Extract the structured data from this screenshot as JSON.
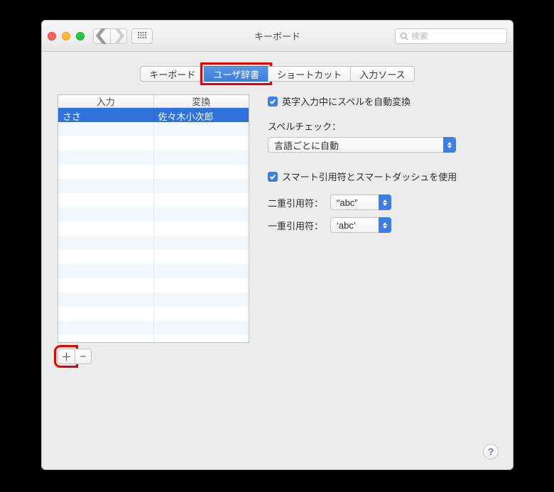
{
  "window": {
    "title": "キーボード",
    "search_placeholder": "検索"
  },
  "tabs": {
    "keyboard": "キーボード",
    "userdict": "ユーザ辞書",
    "shortcuts": "ショートカット",
    "input": "入力ソース"
  },
  "table": {
    "headers": {
      "input": "入力",
      "convert": "変換"
    },
    "rows": [
      {
        "input": "ささ",
        "convert": "佐々木小次郎"
      }
    ]
  },
  "options": {
    "auto_spell_label": "英字入力中にスペルを自動変換",
    "spell_label": "スペルチェック：",
    "spell_value": "言語ごとに自動",
    "smart_quotes_label": "スマート引用符とスマートダッシュを使用",
    "dq_label": "二重引用符：",
    "dq_value": "“abc”",
    "sq_label": "一重引用符：",
    "sq_value": "‘abc’"
  }
}
